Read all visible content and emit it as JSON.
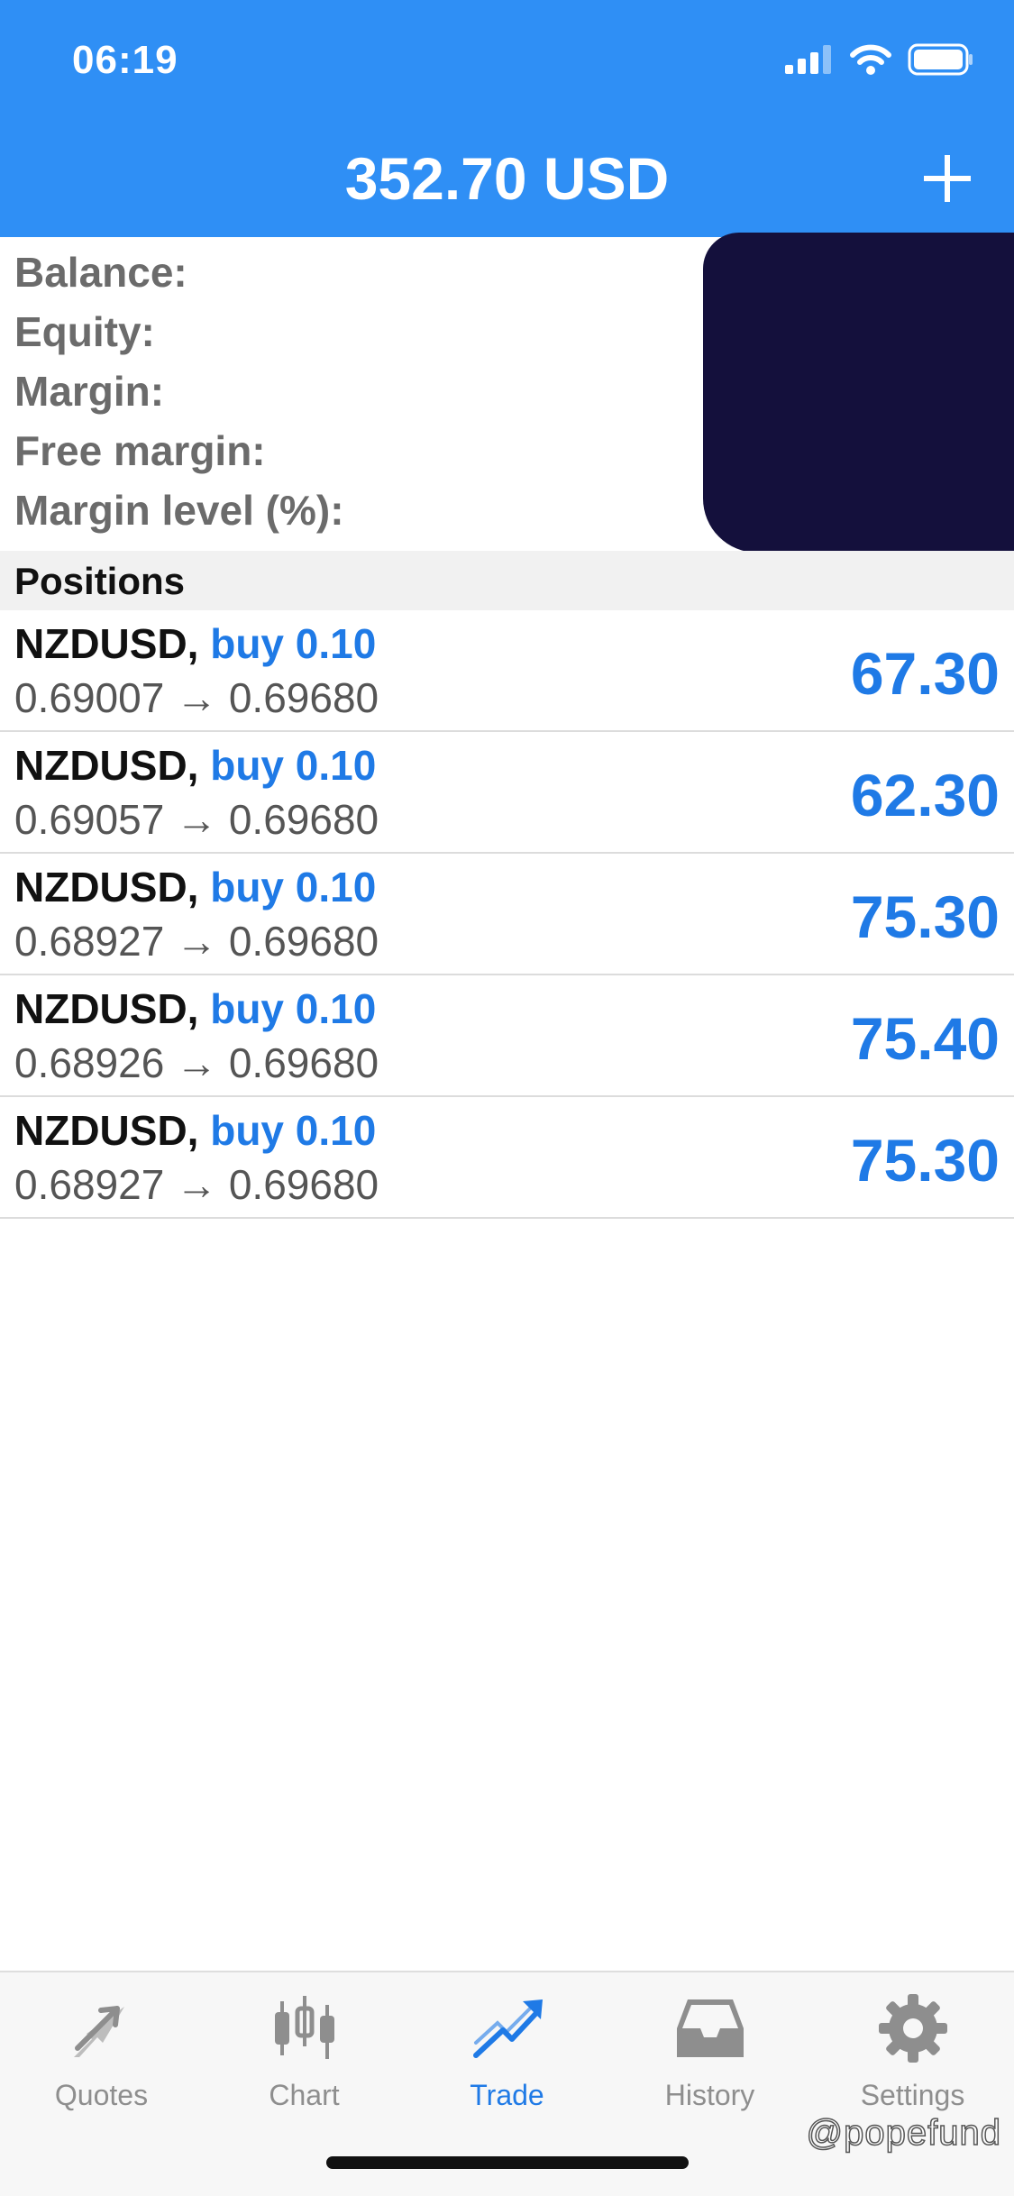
{
  "status_bar": {
    "time": "06:19",
    "signal_icon": "signal-icon",
    "wifi_icon": "wifi-icon",
    "battery_icon": "battery-icon"
  },
  "header": {
    "title": "352.70 USD",
    "add_icon": "plus-icon"
  },
  "account": {
    "balance_label": "Balance:",
    "equity_label": "Equity:",
    "margin_label": "Margin:",
    "free_margin_label": "Free margin:",
    "margin_level_label": "Margin level (%):"
  },
  "positions": {
    "title": "Positions",
    "items": [
      {
        "symbol": "NZDUSD,",
        "side": "buy 0.10",
        "open": "0.69007",
        "arrow": "→",
        "current": "0.69680",
        "profit": "67.30"
      },
      {
        "symbol": "NZDUSD,",
        "side": "buy 0.10",
        "open": "0.69057",
        "arrow": "→",
        "current": "0.69680",
        "profit": "62.30"
      },
      {
        "symbol": "NZDUSD,",
        "side": "buy 0.10",
        "open": "0.68927",
        "arrow": "→",
        "current": "0.69680",
        "profit": "75.30"
      },
      {
        "symbol": "NZDUSD,",
        "side": "buy 0.10",
        "open": "0.68926",
        "arrow": "→",
        "current": "0.69680",
        "profit": "75.40"
      },
      {
        "symbol": "NZDUSD,",
        "side": "buy 0.10",
        "open": "0.68927",
        "arrow": "→",
        "current": "0.69680",
        "profit": "75.30"
      }
    ]
  },
  "tabbar": {
    "tabs": [
      {
        "label": "Quotes",
        "icon": "quotes-icon"
      },
      {
        "label": "Chart",
        "icon": "chart-icon"
      },
      {
        "label": "Trade",
        "icon": "trade-icon",
        "active": true
      },
      {
        "label": "History",
        "icon": "history-icon"
      },
      {
        "label": "Settings",
        "icon": "settings-icon"
      }
    ]
  },
  "watermark": "@popefund",
  "colors": {
    "header": "#2f8ff5",
    "accent": "#1f7ae6",
    "tab_inactive": "#8e8e8e",
    "redaction": "#14103c"
  }
}
